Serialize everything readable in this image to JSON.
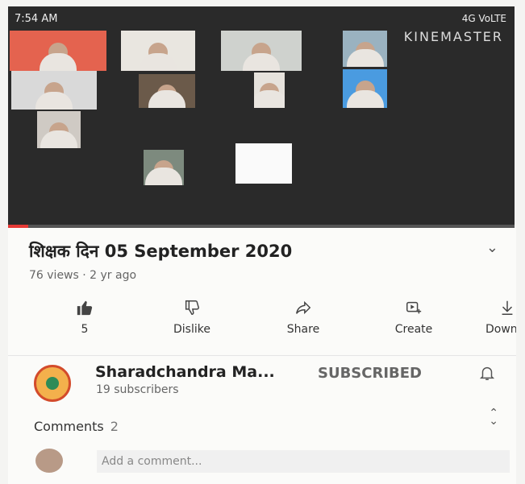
{
  "status": {
    "time": "7:54 AM",
    "network": "4G VoLTE"
  },
  "video": {
    "watermark": "KINEMASTER",
    "progress": 0.04
  },
  "info": {
    "title": "शिक्षक दिन 05 September 2020",
    "meta": "76 views · 2 yr ago"
  },
  "actions": [
    {
      "icon": "thumbs-up-icon",
      "label": "5"
    },
    {
      "icon": "thumbs-down-icon",
      "label": "Dislike"
    },
    {
      "icon": "share-icon",
      "label": "Share"
    },
    {
      "icon": "create-icon",
      "label": "Create"
    },
    {
      "icon": "download-icon",
      "label": "Down"
    }
  ],
  "channel": {
    "name": "Sharadchandra Ma...",
    "subscribers": "19 subscribers",
    "subscribe_label": "SUBSCRIBED"
  },
  "comments": {
    "label": "Comments",
    "count": "2",
    "placeholder": "Add a comment..."
  },
  "colors": {
    "accent": "#e53935",
    "channel_avatar": "#f3b04c"
  }
}
